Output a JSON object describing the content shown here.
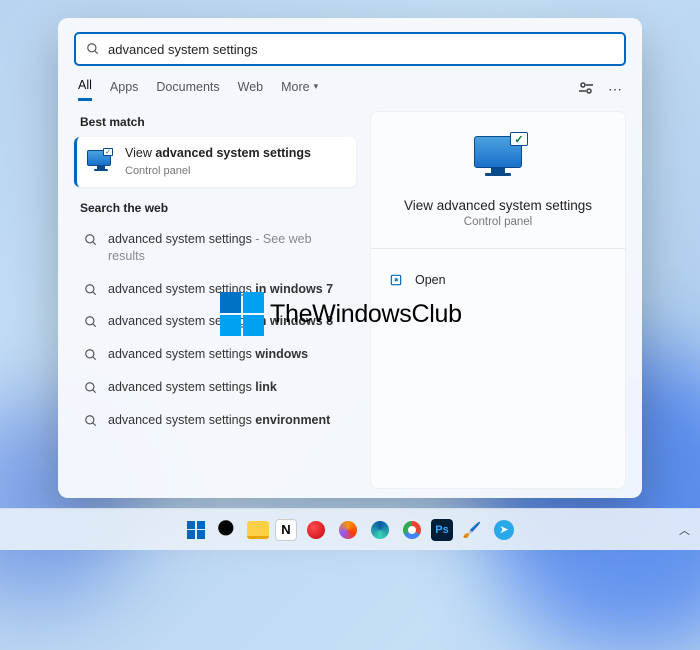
{
  "search": {
    "query": "advanced system settings"
  },
  "tabs": {
    "all": "All",
    "apps": "Apps",
    "documents": "Documents",
    "web": "Web",
    "more": "More"
  },
  "sections": {
    "best_match": "Best match",
    "search_web": "Search the web"
  },
  "best_match": {
    "prefix": "View ",
    "bold": "advanced system settings",
    "subtitle": "Control panel"
  },
  "web_results": [
    {
      "base": "advanced system settings",
      "suffix_light": " - See web results",
      "suffix_bold": ""
    },
    {
      "base": "advanced system settings ",
      "suffix_light": "",
      "suffix_bold": "in windows 7"
    },
    {
      "base": "advanced system settings ",
      "suffix_light": "",
      "suffix_bold": "in windows 8"
    },
    {
      "base": "advanced system settings ",
      "suffix_light": "",
      "suffix_bold": "windows"
    },
    {
      "base": "advanced system settings ",
      "suffix_light": "",
      "suffix_bold": "link"
    },
    {
      "base": "advanced system settings ",
      "suffix_light": "",
      "suffix_bold": "environment"
    }
  ],
  "preview": {
    "title": "View advanced system settings",
    "subtitle": "Control panel",
    "open": "Open"
  },
  "watermark": "TheWindowsClub"
}
